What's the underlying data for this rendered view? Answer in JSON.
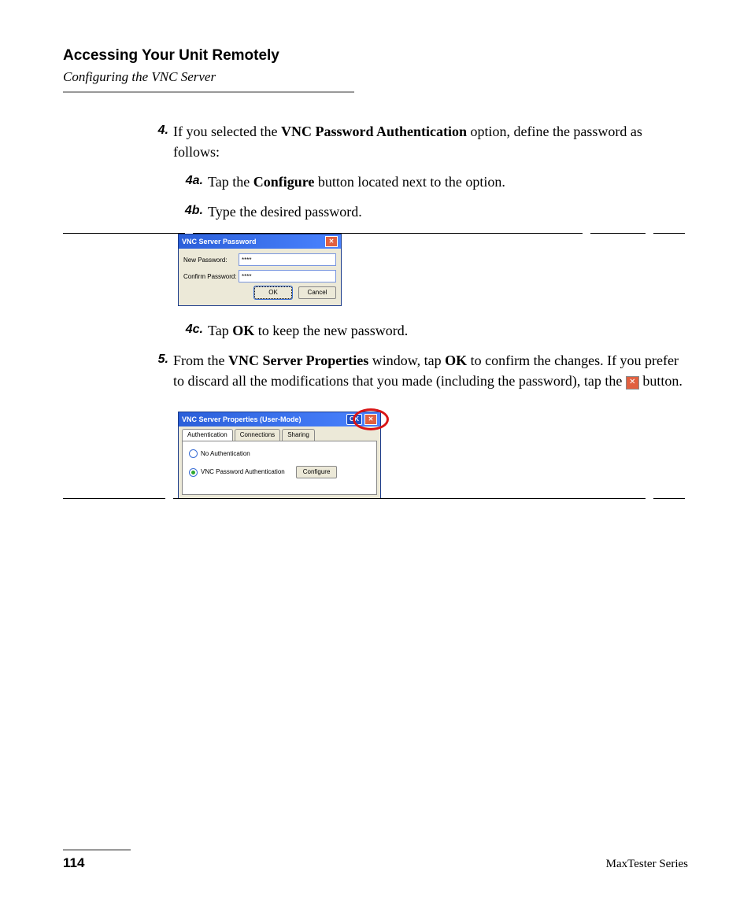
{
  "header": {
    "title": "Accessing Your Unit Remotely",
    "subtitle": "Configuring the VNC Server"
  },
  "steps": {
    "s4": {
      "num": "4.",
      "text_before": "If you selected the ",
      "bold1": "VNC Password Authentication",
      "text_after": " option, define the password as follows:"
    },
    "s4a": {
      "num": "4a.",
      "t1": "Tap the ",
      "b1": "Configure",
      "t2": " button located next to the option."
    },
    "s4b": {
      "num": "4b.",
      "t1": "Type the desired password."
    },
    "s4c": {
      "num": "4c.",
      "t1": "Tap ",
      "b1": "OK",
      "t2": " to keep the new password."
    },
    "s5": {
      "num": "5.",
      "t1": "From the ",
      "b1": "VNC Server Properties",
      "t2": " window, tap ",
      "b2": "OK",
      "t3": " to confirm the changes. If you prefer to discard all the modifications that you made (including the password), tap the ",
      "t4": " button."
    }
  },
  "dlg1": {
    "title": "VNC Server Password",
    "new_label": "New Password:",
    "confirm_label": "Confirm Password:",
    "masked": "****",
    "ok": "OK",
    "cancel": "Cancel"
  },
  "dlg2": {
    "title": "VNC Server Properties (User-Mode)",
    "ok": "OK",
    "tabs": {
      "auth": "Authentication",
      "conn": "Connections",
      "share": "Sharing"
    },
    "radio_none": "No Authentication",
    "radio_vnc": "VNC Password Authentication",
    "configure": "Configure"
  },
  "footer": {
    "page": "114",
    "series": "MaxTester Series"
  }
}
